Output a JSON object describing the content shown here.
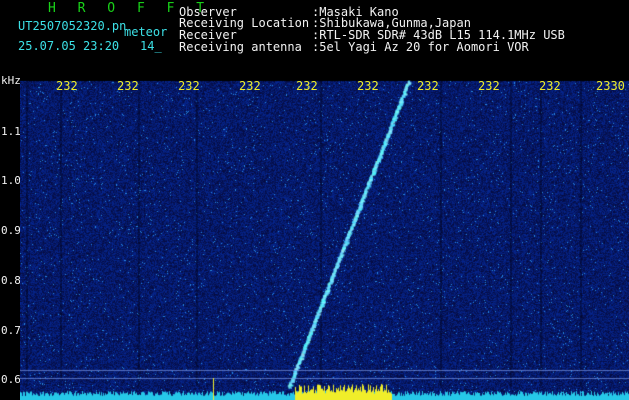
{
  "header": {
    "app_name": "H R O F F T",
    "filename": "UT2507052320.pn",
    "type_label": "meteor",
    "datetime": "25.07.05 23:20",
    "seq": "14_",
    "labels": {
      "observer": "Observer",
      "location": "Receiving Location",
      "receiver": "Receiver",
      "antenna": "Receiving antenna"
    },
    "values": {
      "observer": ":Masaki Kano",
      "location": ":Shibukawa,Gunma,Japan",
      "receiver": ":RTL-SDR SDR# 43dB L15 114.1MHz USB",
      "antenna": ":5el Yagi Az 20 for Aomori VOR"
    }
  },
  "colors": {
    "background": "#000000",
    "spectrum_low": "#0a0f5a",
    "spectrum_high": "#3ce0e6",
    "label_yellow": "#f0ee2a",
    "app_green": "#19d219"
  },
  "spectrogram": {
    "unit_label": "kHz",
    "y_ticks": [
      "1.1",
      "1.0",
      "0.9",
      "0.8",
      "0.7",
      "0.6"
    ],
    "time_ticks": [
      "232",
      "232",
      "232",
      "232",
      "232",
      "232",
      "232",
      "232",
      "232",
      "2330"
    ]
  }
}
